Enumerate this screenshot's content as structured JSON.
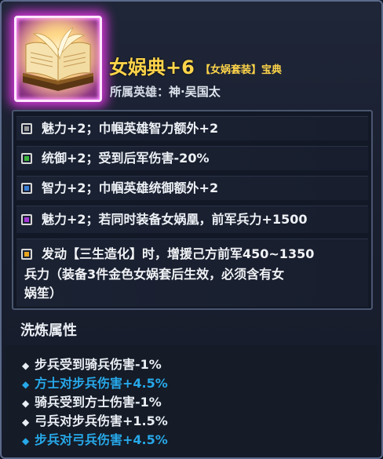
{
  "item": {
    "name": "女娲典+6",
    "set_tag": "【女娲套装】宝典",
    "hero_label": "所属英雄：",
    "hero_name": "神·吴国太",
    "icon": "open-book-icon"
  },
  "attributes": [
    {
      "color": "#9a9a9a",
      "text": "魅力+2；巾帼英雄智力额外+2"
    },
    {
      "color": "#3db63d",
      "text": "统御+2；受到后军伤害-20%"
    },
    {
      "color": "#3b7fd6",
      "text": "智力+2；巾帼英雄统御额外+2"
    },
    {
      "color": "#a53ad6",
      "text": "魅力+2；若同时装备女娲凰，前军兵力+1500"
    },
    {
      "color": "#e8a51f",
      "lines": [
        "发动【三生造化】时，增援己方前军450~1350",
        "兵力（装备3件金色女娲套后生效，必须含有女",
        "娲笙）"
      ]
    }
  ],
  "refine": {
    "title": "洗炼属性",
    "lines": [
      {
        "text": "步兵受到骑兵伤害-1%",
        "color": "white"
      },
      {
        "text": "方士对步兵伤害+4.5%",
        "color": "blue"
      },
      {
        "text": "骑兵受到方士伤害-1%",
        "color": "white"
      },
      {
        "text": "弓兵对步兵伤害+1.5%",
        "color": "white"
      },
      {
        "text": "步兵对弓兵伤害+4.5%",
        "color": "blue"
      }
    ]
  }
}
